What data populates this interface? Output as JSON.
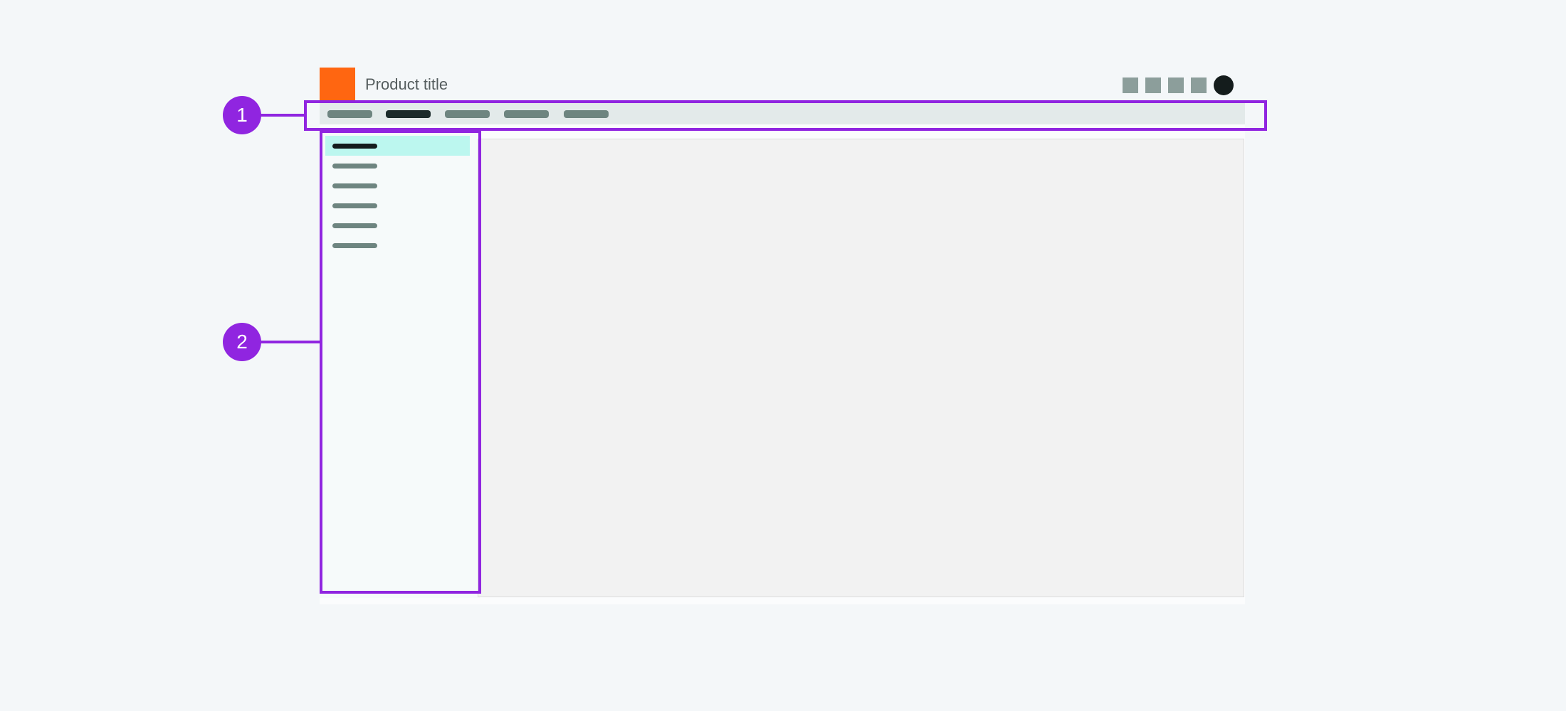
{
  "header": {
    "product_title": "Product title",
    "logo_color": "#ff6611",
    "action_icons": [
      "action-icon-1",
      "action-icon-2",
      "action-icon-3",
      "action-icon-4"
    ],
    "avatar_icon": "user-avatar"
  },
  "tabs": {
    "count": 5,
    "active_index": 1
  },
  "sidenav": {
    "count": 6,
    "active_index": 0
  },
  "annotations": {
    "marker_1": "1",
    "marker_2": "2",
    "color": "#9025e0"
  }
}
